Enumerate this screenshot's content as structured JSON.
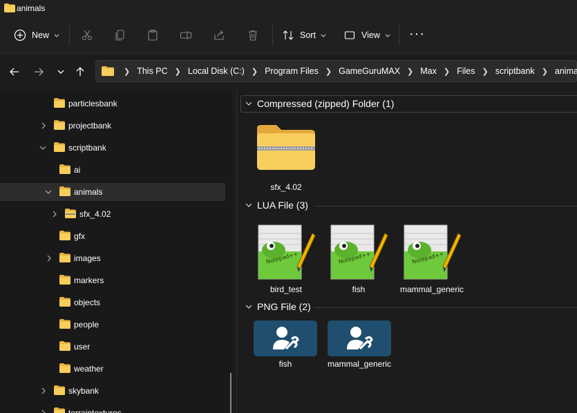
{
  "window": {
    "title": "animals"
  },
  "toolbar": {
    "new_label": "New",
    "sort_label": "Sort",
    "view_label": "View",
    "more_label": "···"
  },
  "address": {
    "crumbs": [
      "This PC",
      "Local Disk (C:)",
      "Program Files",
      "GameGuruMAX",
      "Max",
      "Files",
      "scriptbank",
      "animals"
    ]
  },
  "tree": {
    "items": [
      {
        "label": "particlesbank"
      },
      {
        "label": "projectbank"
      },
      {
        "label": "scriptbank"
      },
      {
        "label": "ai"
      },
      {
        "label": "animals"
      },
      {
        "label": "sfx_4.02"
      },
      {
        "label": "gfx"
      },
      {
        "label": "images"
      },
      {
        "label": "markers"
      },
      {
        "label": "objects"
      },
      {
        "label": "people"
      },
      {
        "label": "user"
      },
      {
        "label": "weather"
      },
      {
        "label": "skybank"
      },
      {
        "label": "terraintextures"
      }
    ]
  },
  "groups": [
    {
      "header": "Compressed (zipped) Folder (1)",
      "items": [
        {
          "name": "sfx_4.02"
        }
      ]
    },
    {
      "header": "LUA File (3)",
      "items": [
        {
          "name": "bird_test"
        },
        {
          "name": "fish"
        },
        {
          "name": "mammal_generic"
        }
      ]
    },
    {
      "header": "PNG File (2)",
      "items": [
        {
          "name": "fish"
        },
        {
          "name": "mammal_generic"
        }
      ]
    }
  ],
  "colors": {
    "folder": "#f2c14e",
    "selection": "#2d2d2d",
    "png_tile": "#1f4e6e"
  }
}
